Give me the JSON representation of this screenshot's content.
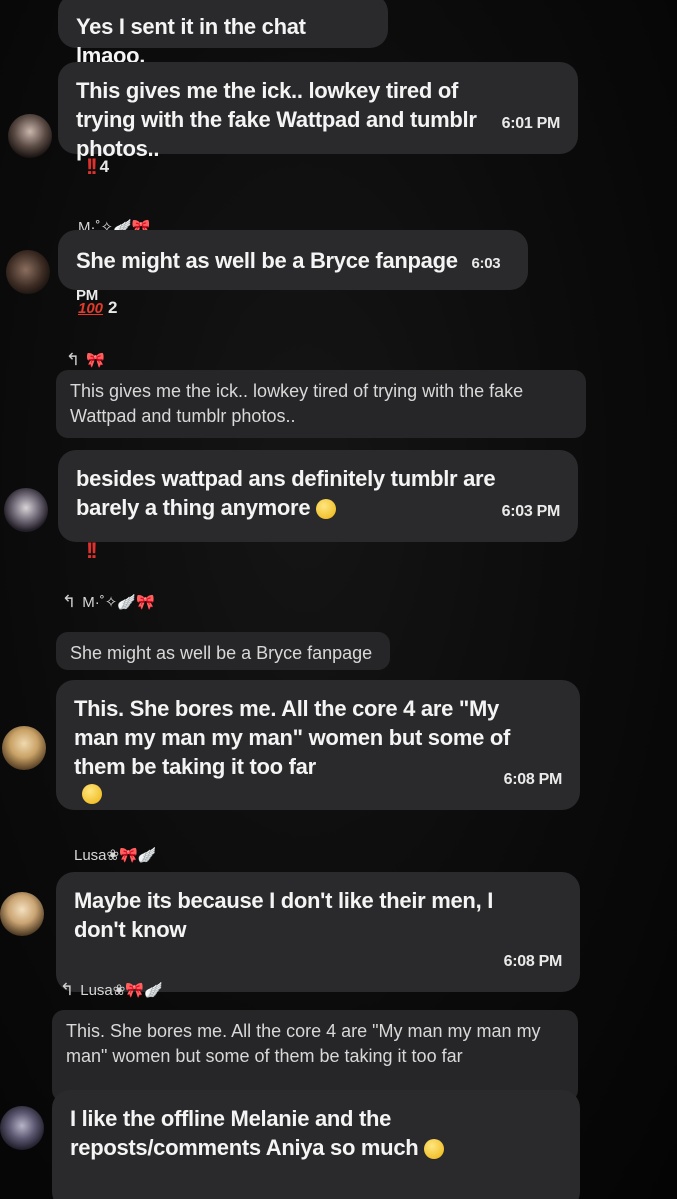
{
  "messages": [
    {
      "text": "Yes I sent it in the chat lmaoo."
    },
    {
      "text": "This gives me the ick.. lowkey tired of trying with the fake Wattpad and tumblr photos..",
      "time": "6:01 PM",
      "reaction": {
        "emoji": "‼️",
        "count": "4"
      }
    },
    {
      "sender": "M·˚✧🪽🎀",
      "text": "She might as well be a Bryce fanpage",
      "time": "6:03 PM",
      "reaction": {
        "emoji": "💯",
        "count": "2"
      }
    },
    {
      "reply_sender": "🎀",
      "quote": "This gives me the ick.. lowkey tired of trying with the fake Wattpad and tumblr photos..",
      "text": "besides wattpad ans definitely tumblr are barely a thing anymore",
      "time": "6:03 PM",
      "reaction": {
        "emoji": "‼️"
      }
    },
    {
      "reply_sender": "M·˚✧🪽🎀",
      "quote": "She might as well be a Bryce fanpage",
      "text": "This. She bores me. All the core 4 are \"My man my man my man\" women but some of them be taking it too far",
      "time": "6:08 PM"
    },
    {
      "sender": "Lusa❀🎀🪽",
      "text": "Maybe its because I don't like their men, I don't know",
      "time": "6:08 PM"
    },
    {
      "reply_sender": "Lusa❀🎀🪽",
      "quote": "This. She bores me. All the core 4 are \"My man my man my man\" women but some of them be taking it too far",
      "text": "I like the offline Melanie and the reposts/comments Aniya so much"
    }
  ],
  "icons": {
    "reply": "reply-arrow-icon",
    "bow": "pink-bow-icon"
  },
  "colors": {
    "bubble": "#2a2a2c",
    "background": "#050505",
    "reaction_red": "#e0312e"
  }
}
